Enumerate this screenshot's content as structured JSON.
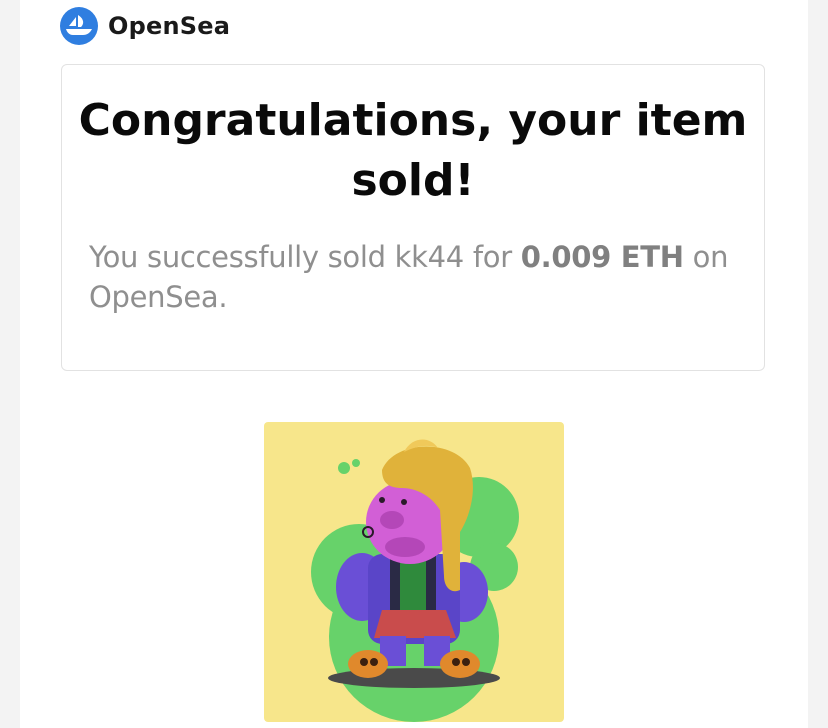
{
  "brand": {
    "name": "OpenSea",
    "logo_icon": "opensea-boat-icon",
    "color": "#2f7ee0"
  },
  "card": {
    "title": "Congratulations, your item sold!",
    "message_prefix": "You successfully sold kk44 for ",
    "price": "0.009 ETH",
    "message_suffix": " on OpenSea."
  },
  "item": {
    "image_icon": "nft-character-image",
    "background_color": "#f7e68b"
  }
}
